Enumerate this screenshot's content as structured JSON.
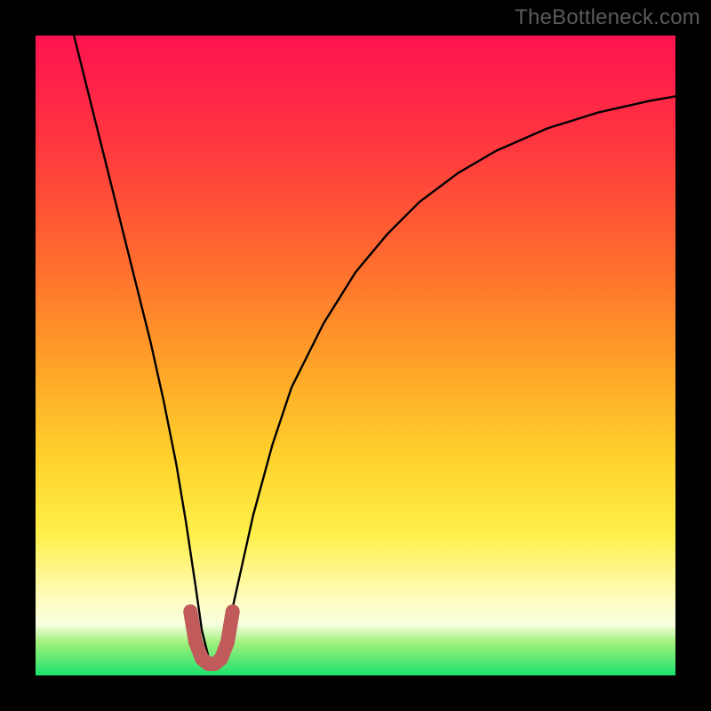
{
  "watermark": "TheBottleneck.com",
  "chart_data": {
    "type": "line",
    "title": "",
    "xlabel": "",
    "ylabel": "",
    "xlim": [
      0,
      100
    ],
    "ylim": [
      0,
      100
    ],
    "series": [
      {
        "name": "bottleneck-curve",
        "x": [
          6,
          8,
          10,
          12,
          14,
          16,
          18,
          20,
          22,
          23.5,
          25,
          26,
          27,
          28,
          29,
          30,
          32,
          34,
          37,
          40,
          45,
          50,
          55,
          60,
          66,
          72,
          80,
          88,
          96,
          100
        ],
        "values": [
          100,
          92,
          84,
          76,
          68,
          60,
          52,
          43,
          33,
          24,
          14,
          7,
          3,
          2,
          3,
          7,
          16,
          25,
          36,
          45,
          55,
          63,
          69,
          74,
          78.5,
          82,
          85.5,
          88,
          89.8,
          90.5
        ]
      },
      {
        "name": "optimal-highlight",
        "x": [
          24.2,
          25,
          26,
          27,
          28,
          29,
          30,
          30.8
        ],
        "values": [
          10,
          5.2,
          2.6,
          1.8,
          1.8,
          2.6,
          5.2,
          10
        ]
      }
    ],
    "colors": {
      "curve": "#000000",
      "highlight": "#c15a5a"
    }
  }
}
